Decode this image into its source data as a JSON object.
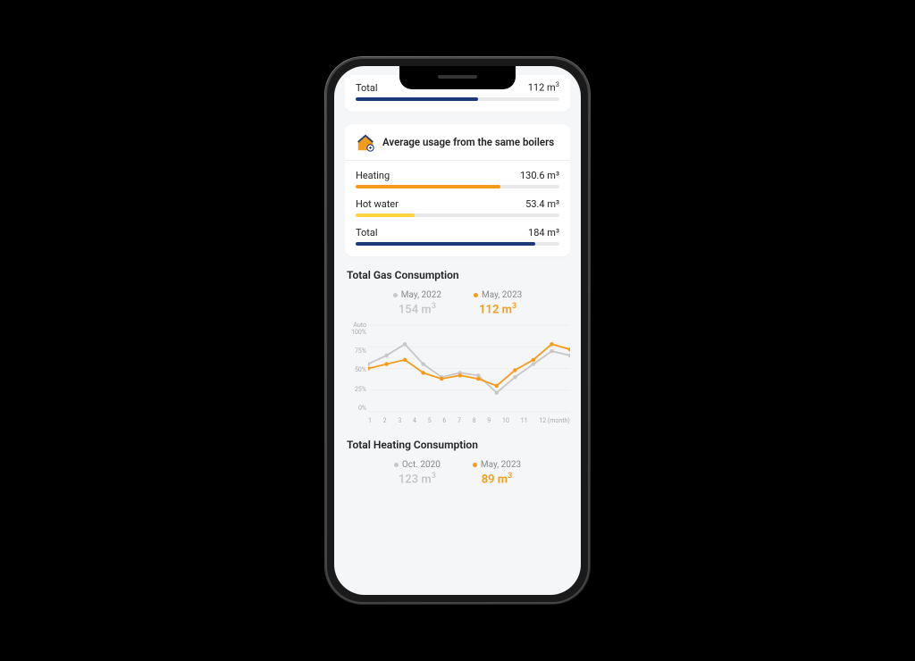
{
  "top_total": {
    "label": "Total",
    "value": "112 m³",
    "fill_pct": 60,
    "color": "#1a3a7a"
  },
  "avg_card": {
    "title": "Average usage from the same boilers",
    "rows": [
      {
        "label": "Heating",
        "value": "130.6 m³",
        "fill_pct": 71,
        "color": "#f59b1b"
      },
      {
        "label": "Hot water",
        "value": "53.4 m³",
        "fill_pct": 29,
        "color": "#ffd23f"
      },
      {
        "label": "Total",
        "value": "184 m³",
        "fill_pct": 88,
        "color": "#1a3a7a"
      }
    ]
  },
  "gas_section": {
    "title": "Total Gas Consumption",
    "legend": [
      {
        "period": "May, 2022",
        "value": "154 m³",
        "color": "#c7c7c7"
      },
      {
        "period": "May, 2023",
        "value": "112 m³",
        "color": "#f59b1b"
      }
    ],
    "y_ticks": [
      "Auto\n100%",
      "75%",
      "50%",
      "25%",
      "0%"
    ],
    "x_ticks": [
      "1",
      "2",
      "3",
      "4",
      "5",
      "6",
      "7",
      "8",
      "9",
      "10",
      "11",
      "12 (month)"
    ]
  },
  "heating_section": {
    "title": "Total Heating Consumption",
    "legend": [
      {
        "period": "Oct. 2020",
        "value": "123 m³",
        "color": "#c7c7c7"
      },
      {
        "period": "May, 2023",
        "value": "89 m³",
        "color": "#f59b1b"
      }
    ]
  },
  "chart_data": {
    "type": "line",
    "title": "Total Gas Consumption",
    "xlabel": "(month)",
    "ylabel": "",
    "ylim": [
      0,
      100
    ],
    "categories": [
      1,
      2,
      3,
      4,
      5,
      6,
      7,
      8,
      9,
      10,
      11,
      12
    ],
    "series": [
      {
        "name": "May, 2022",
        "color": "#c7c7c7",
        "values": [
          55,
          65,
          78,
          55,
          40,
          45,
          42,
          22,
          40,
          55,
          70,
          65
        ]
      },
      {
        "name": "May, 2023",
        "color": "#f59b1b",
        "values": [
          50,
          55,
          60,
          45,
          38,
          42,
          38,
          30,
          48,
          60,
          78,
          72
        ]
      }
    ]
  },
  "colors": {
    "orange": "#f59b1b",
    "yellow": "#ffd23f",
    "navy": "#1a3a7a",
    "grey": "#c7c7c7"
  }
}
